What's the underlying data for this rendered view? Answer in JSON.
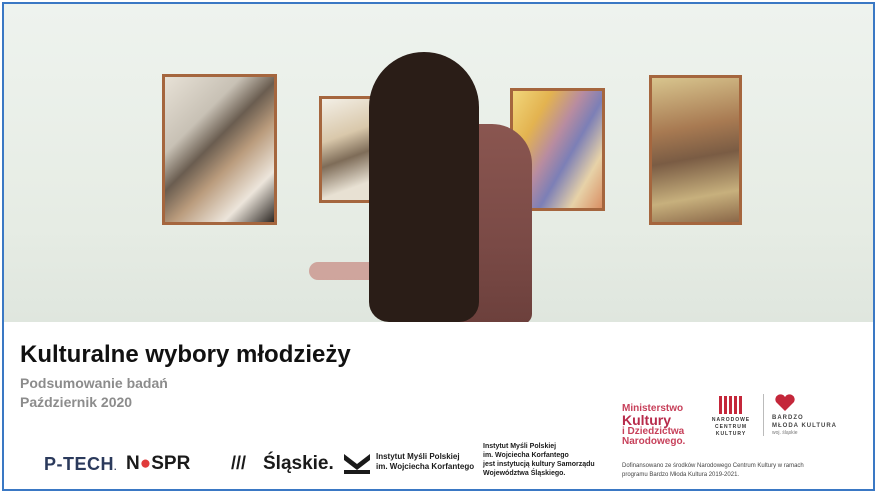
{
  "slide": {
    "title": "Kulturalne wybory młodzieży",
    "subtitle": "Podsumowanie badań",
    "date": "Październik 2020"
  },
  "logos": {
    "ptech": "P-TECH",
    "ptech_dot": ".",
    "nospr_n": "N",
    "nospr_o": "●",
    "nospr_rest": "SPR",
    "slaskie_mark": "///",
    "slaskie": "Śląskie.",
    "imp_line1": "Instytut Myśli Polskiej",
    "imp_line2": "im. Wojciecha Korfantego"
  },
  "imp_note": {
    "line1": "Instytut Myśli Polskiej",
    "line2": "im. Wojciecha Korfantego",
    "line3": "jest instytucją kultury Samorządu",
    "line4": "Województwa Śląskiego."
  },
  "sponsors": {
    "mkidn_line1": "Ministerstwo",
    "mkidn_line2": "Kultury",
    "mkidn_line3": "i Dziedzictwa",
    "mkidn_line4": "Narodowego.",
    "nck_line1": "NARODOWE",
    "nck_line2": "CENTRUM",
    "nck_line3": "KULTURY",
    "bmk_line1": "BARDZO",
    "bmk_line2": "MŁODA KULTURA",
    "bmk_line3": "woj. śląskie",
    "note_line1": "Dofinansowano ze środków Narodowego Centrum Kultury w ramach",
    "note_line2": "programu Bardzo Młoda Kultura 2019-2021."
  },
  "colors": {
    "frame_border": "#3a78c4",
    "title": "#111111",
    "subtitle": "#8c8c8c",
    "mkidn_accent": "#c7405a"
  }
}
